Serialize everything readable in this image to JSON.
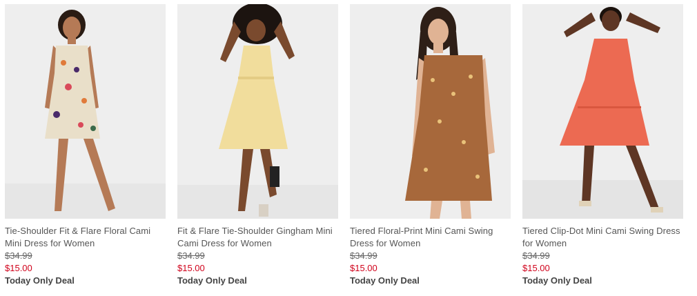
{
  "products": [
    {
      "title": "Tie-Shoulder Fit & Flare Floral Cami Mini Dress for Women",
      "original_price": "$34.99",
      "sale_price": "$15.00",
      "deal_label": "Today Only Deal",
      "dress_color": "#e9dfc9",
      "skin_color": "#b57a56",
      "hair_color": "#2a1c14"
    },
    {
      "title": "Fit & Flare Tie-Shoulder Gingham Mini Cami Dress for Women",
      "original_price": "$34.99",
      "sale_price": "$15.00",
      "deal_label": "Today Only Deal",
      "dress_color": "#f1dd9c",
      "skin_color": "#7a4a2e",
      "hair_color": "#1c1410"
    },
    {
      "title": "Tiered Floral-Print Mini Cami Swing Dress for Women",
      "original_price": "$34.99",
      "sale_price": "$15.00",
      "deal_label": "Today Only Deal",
      "dress_color": "#a7683b",
      "skin_color": "#e0b394",
      "hair_color": "#2e1f17"
    },
    {
      "title": "Tiered Clip-Dot Mini Cami Swing Dress for Women",
      "original_price": "$34.99",
      "sale_price": "$15.00",
      "deal_label": "Today Only Deal",
      "dress_color": "#ec6a52",
      "skin_color": "#5e3624",
      "hair_color": "#1a110c"
    }
  ]
}
